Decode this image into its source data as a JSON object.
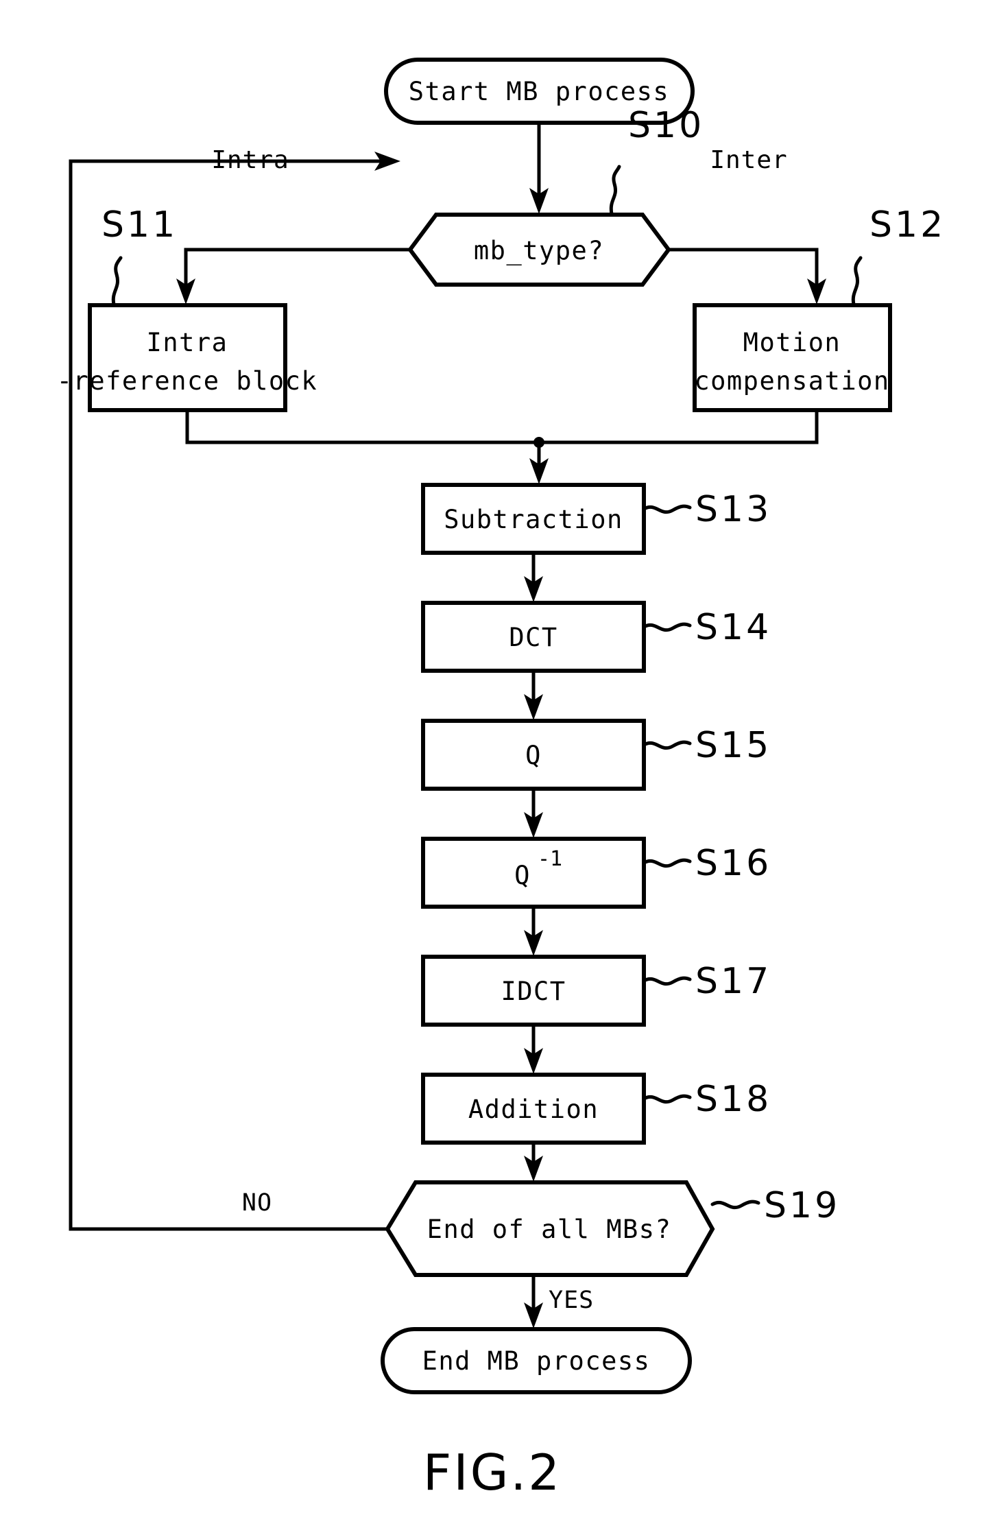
{
  "figure": {
    "caption": "FIG.2",
    "title": "MB process flowchart"
  },
  "nodes": {
    "start": {
      "label": "Start MB process",
      "shape": "terminator"
    },
    "decision_mb_type": {
      "label": "mb_type?",
      "shape": "hexagon",
      "step": "S10"
    },
    "intra_block": {
      "label_line1": "Intra",
      "label_line2": "-reference block",
      "shape": "process",
      "step": "S11"
    },
    "motion_block": {
      "label_line1": "Motion",
      "label_line2": "compensation",
      "shape": "process",
      "step": "S12"
    },
    "subtraction": {
      "label": "Subtraction",
      "shape": "process",
      "step": "S13"
    },
    "dct": {
      "label": "DCT",
      "shape": "process",
      "step": "S14"
    },
    "quant": {
      "label": "Q",
      "shape": "process",
      "step": "S15"
    },
    "dequant": {
      "label": "Q",
      "superscript": "-1",
      "shape": "process",
      "step": "S16"
    },
    "idct": {
      "label": "IDCT",
      "shape": "process",
      "step": "S17"
    },
    "addition": {
      "label": "Addition",
      "shape": "process",
      "step": "S18"
    },
    "decision_end": {
      "label": "End of all MBs?",
      "shape": "hexagon",
      "step": "S19"
    },
    "end": {
      "label": "End MB process",
      "shape": "terminator"
    }
  },
  "edge_labels": {
    "intra": "Intra",
    "inter": "Inter",
    "no": "NO",
    "yes": "YES"
  },
  "colors": {
    "line": "#000000",
    "fill": "#ffffff",
    "background": "#ffffff"
  },
  "chart_data": {
    "type": "diagram",
    "title": "FIG.2",
    "nodes": [
      {
        "id": "start",
        "step": null,
        "text": "Start MB process",
        "shape": "terminator"
      },
      {
        "id": "s10",
        "step": "S10",
        "text": "mb_type?",
        "shape": "decision"
      },
      {
        "id": "s11",
        "step": "S11",
        "text": "Intra -reference block",
        "shape": "process"
      },
      {
        "id": "s12",
        "step": "S12",
        "text": "Motion compensation",
        "shape": "process"
      },
      {
        "id": "s13",
        "step": "S13",
        "text": "Subtraction",
        "shape": "process"
      },
      {
        "id": "s14",
        "step": "S14",
        "text": "DCT",
        "shape": "process"
      },
      {
        "id": "s15",
        "step": "S15",
        "text": "Q",
        "shape": "process"
      },
      {
        "id": "s16",
        "step": "S16",
        "text": "Q-1",
        "shape": "process"
      },
      {
        "id": "s17",
        "step": "S17",
        "text": "IDCT",
        "shape": "process"
      },
      {
        "id": "s18",
        "step": "S18",
        "text": "Addition",
        "shape": "process"
      },
      {
        "id": "s19",
        "step": "S19",
        "text": "End of all MBs?",
        "shape": "decision"
      },
      {
        "id": "end",
        "step": null,
        "text": "End MB process",
        "shape": "terminator"
      }
    ],
    "edges": [
      {
        "from": "start",
        "to": "s10",
        "label": ""
      },
      {
        "from": "s10",
        "to": "s11",
        "label": "Intra"
      },
      {
        "from": "s10",
        "to": "s12",
        "label": "Inter"
      },
      {
        "from": "s11",
        "to": "s13",
        "label": ""
      },
      {
        "from": "s12",
        "to": "s13",
        "label": ""
      },
      {
        "from": "s13",
        "to": "s14",
        "label": ""
      },
      {
        "from": "s14",
        "to": "s15",
        "label": ""
      },
      {
        "from": "s15",
        "to": "s16",
        "label": ""
      },
      {
        "from": "s16",
        "to": "s17",
        "label": ""
      },
      {
        "from": "s17",
        "to": "s18",
        "label": ""
      },
      {
        "from": "s18",
        "to": "s19",
        "label": ""
      },
      {
        "from": "s19",
        "to": "s10",
        "label": "NO"
      },
      {
        "from": "s19",
        "to": "end",
        "label": "YES"
      }
    ]
  }
}
